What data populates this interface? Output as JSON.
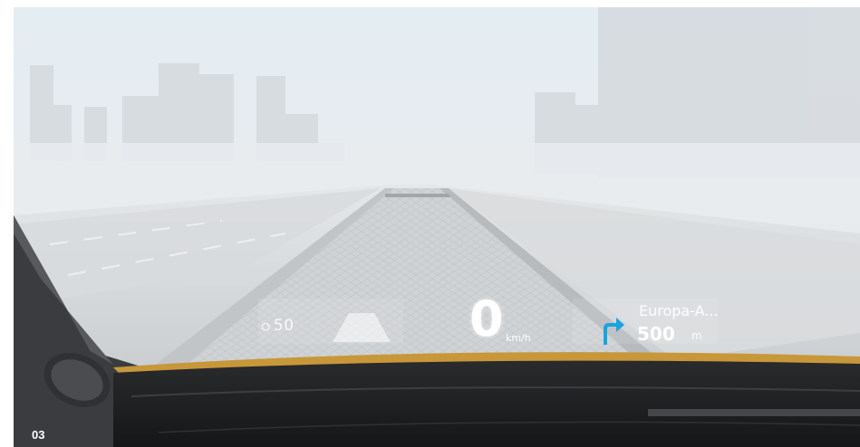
{
  "hud": {
    "speed_limit": {
      "prefix": "⛭",
      "value": "50"
    },
    "speed": {
      "value": "0",
      "unit": "km/h"
    },
    "navigation": {
      "street": "Europa-A...",
      "distance": "500",
      "distance_unit": "m",
      "maneuver_icon": "turn-right-arrow-icon",
      "arrow_color": "#1aa3e0"
    },
    "lane_icon": "lane-assist-icon"
  },
  "caption": "03",
  "colors": {
    "sky": "#e6edf2",
    "fog": "#dfe4e8",
    "dashboard": "#1c1d1f",
    "hood_trim": "#c8973a"
  }
}
